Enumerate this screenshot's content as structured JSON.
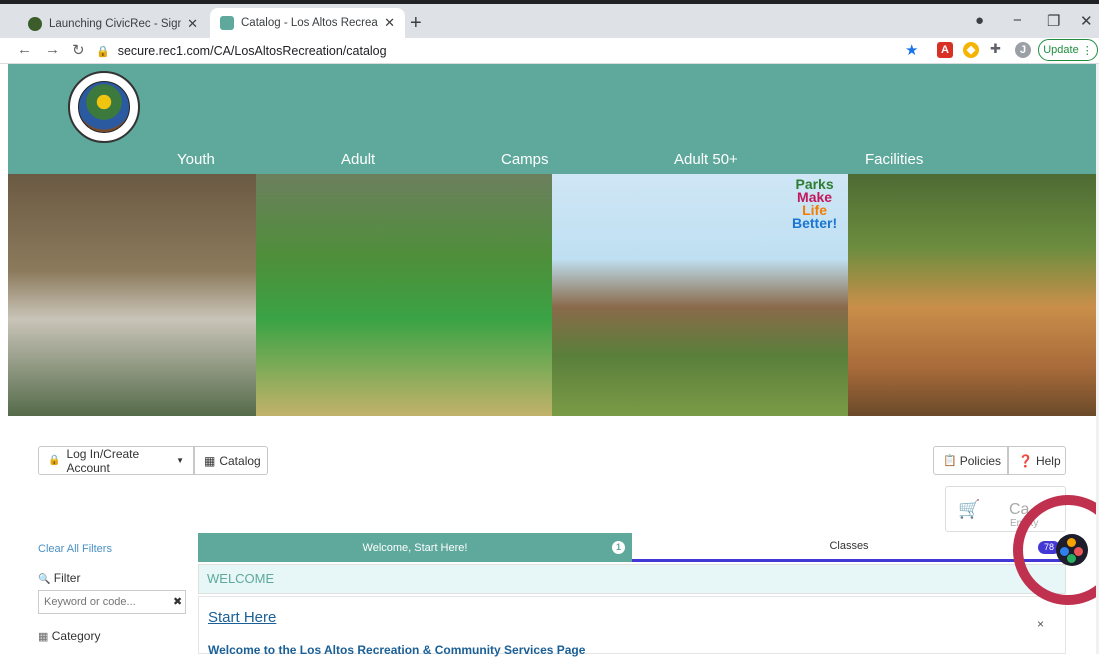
{
  "browser": {
    "tabs": [
      {
        "title": "Launching CivicRec - Sign-Up for",
        "close": "✕",
        "active": false
      },
      {
        "title": "Catalog - Los Altos Recreation",
        "close": "✕",
        "active": true
      }
    ],
    "new_tab": "+",
    "url": "secure.rec1.com/CA/LosAltosRecreation/catalog",
    "profile_initial": "J",
    "update_label": "Update"
  },
  "site": {
    "nav": [
      "Youth",
      "Adult",
      "Camps",
      "Adult 50+",
      "Facilities"
    ],
    "hero_text": {
      "line1": "Parks",
      "line2": "Make",
      "line3": "Life",
      "line4": "Better!"
    }
  },
  "toolbar": {
    "login": "Log In/Create Account",
    "catalog": "Catalog",
    "policies": "Policies",
    "help": "Help"
  },
  "cart": {
    "title": "Ca",
    "subtitle": "Empty"
  },
  "filters": {
    "clear_all": "Clear All Filters",
    "filter_label": "Filter",
    "keyword_placeholder": "Keyword or code...",
    "category_label": "Category"
  },
  "catalog_tabs": [
    {
      "label": "Welcome, Start Here!",
      "count": "1"
    },
    {
      "label": "Classes",
      "count": "78"
    }
  ],
  "welcome": {
    "section_title": "WELCOME",
    "start_here": "Start Here",
    "body_heading": "Welcome to the Los Altos Recreation & Community Services Page",
    "close": "×"
  },
  "colors": {
    "brand_teal": "#5ea99c",
    "accent_blue": "#4338d6",
    "ring": "#c0304f"
  }
}
